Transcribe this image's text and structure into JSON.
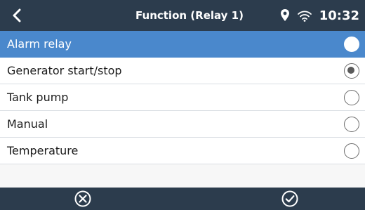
{
  "header": {
    "title": "Function (Relay 1)",
    "time": "10:32"
  },
  "options": [
    {
      "label": "Alarm relay",
      "selected_row": true,
      "checked": false
    },
    {
      "label": "Generator start/stop",
      "selected_row": false,
      "checked": true
    },
    {
      "label": "Tank pump",
      "selected_row": false,
      "checked": false
    },
    {
      "label": "Manual",
      "selected_row": false,
      "checked": false
    },
    {
      "label": "Temperature",
      "selected_row": false,
      "checked": false
    }
  ],
  "icons": {
    "back": "chevron-left-icon",
    "location": "location-pin-icon",
    "wifi": "wifi-icon",
    "cancel": "cancel-circle-icon",
    "confirm": "confirm-check-circle-icon"
  },
  "colors": {
    "header_bg": "#2c3c4d",
    "highlight_bg": "#4a88cc",
    "text": "#1b1b1b",
    "divider": "#d9dde2"
  }
}
